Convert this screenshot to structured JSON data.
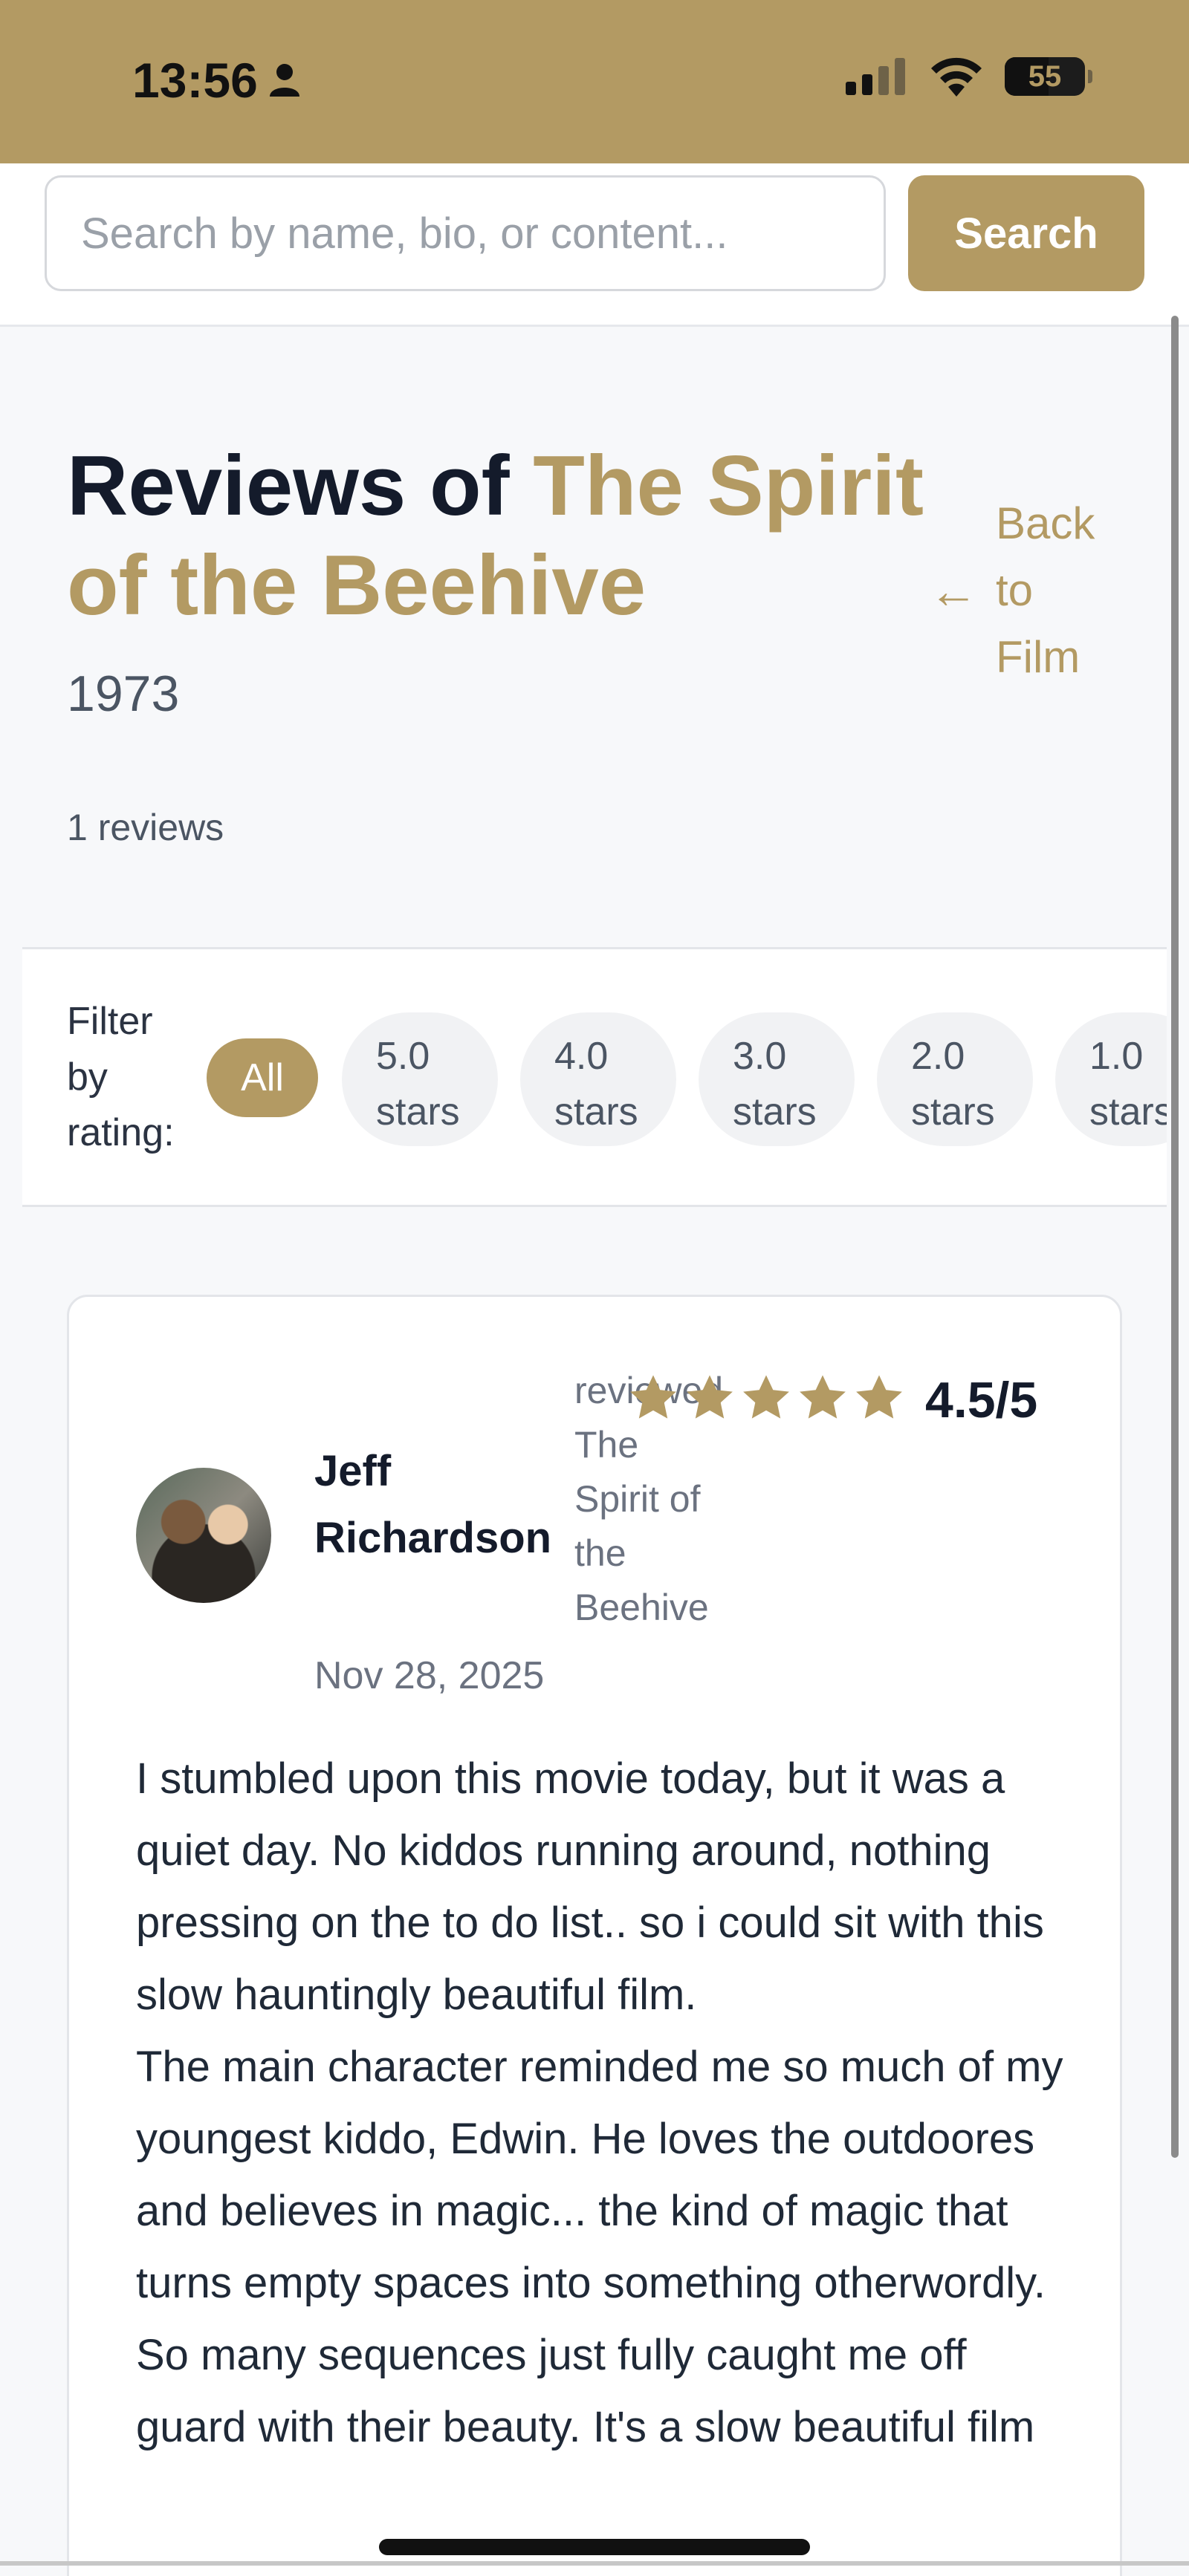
{
  "status": {
    "time": "13:56",
    "battery": "55"
  },
  "search": {
    "placeholder": "Search by name, bio, or content...",
    "button_label": "Search"
  },
  "header": {
    "title_prefix": "Reviews of ",
    "film_title": "The Spirit of the Beehive",
    "year": "1973",
    "review_count": "1 reviews",
    "back_label": "Back to Film"
  },
  "filter": {
    "label": "Filter by rating:",
    "options": [
      "All",
      "5.0 stars",
      "4.0 stars",
      "3.0 stars",
      "2.0 stars",
      "1.0 stars"
    ],
    "selected": "All"
  },
  "review": {
    "reviewer": "Jeff Richardson",
    "reviewed_label": "reviewed The Spirit of the Beehive",
    "rating_text": "4.5/5",
    "rating_value": 4.5,
    "date": "Nov 28, 2025",
    "body": "I stumbled upon this movie today, but it was a quiet day. No kiddos running around, nothing pressing on the to do list.. so i could sit with this slow hauntingly beautiful film.\nThe main character reminded me so much of my youngest kiddo, Edwin. He loves the outdoores and believes in magic... the kind of magic that turns empty spaces into something otherwordly. So many sequences just fully caught me off guard with their beauty. It's a slow beautiful film"
  },
  "colors": {
    "accent": "#b39a63",
    "text": "#141b2b",
    "muted": "#6b7280"
  }
}
